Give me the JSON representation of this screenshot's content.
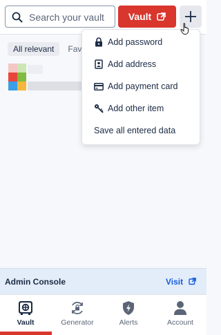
{
  "search": {
    "placeholder": "Search your vault"
  },
  "header": {
    "vault_label": "Vault"
  },
  "filters": {
    "all_relevant": "All relevant",
    "favorites_partial": "Fav"
  },
  "add_menu": {
    "items": [
      {
        "label": "Add password",
        "icon": "lock-icon"
      },
      {
        "label": "Add address",
        "icon": "id-card-icon"
      },
      {
        "label": "Add payment card",
        "icon": "credit-card-icon"
      },
      {
        "label": "Add other item",
        "icon": "key-icon"
      },
      {
        "label": "Save all entered data"
      }
    ]
  },
  "admin_console": {
    "label": "Admin Console",
    "link": "Visit"
  },
  "nav": {
    "items": [
      {
        "label": "Vault",
        "icon": "vault-icon",
        "active": true
      },
      {
        "label": "Generator",
        "icon": "generator-icon"
      },
      {
        "label": "Alerts",
        "icon": "shield-alert-icon"
      },
      {
        "label": "Account",
        "icon": "person-icon"
      }
    ]
  },
  "colors": {
    "accent": "#d9362e",
    "link": "#175ddc",
    "text": "#1b2a44",
    "admin_bg": "#e3edf9"
  }
}
